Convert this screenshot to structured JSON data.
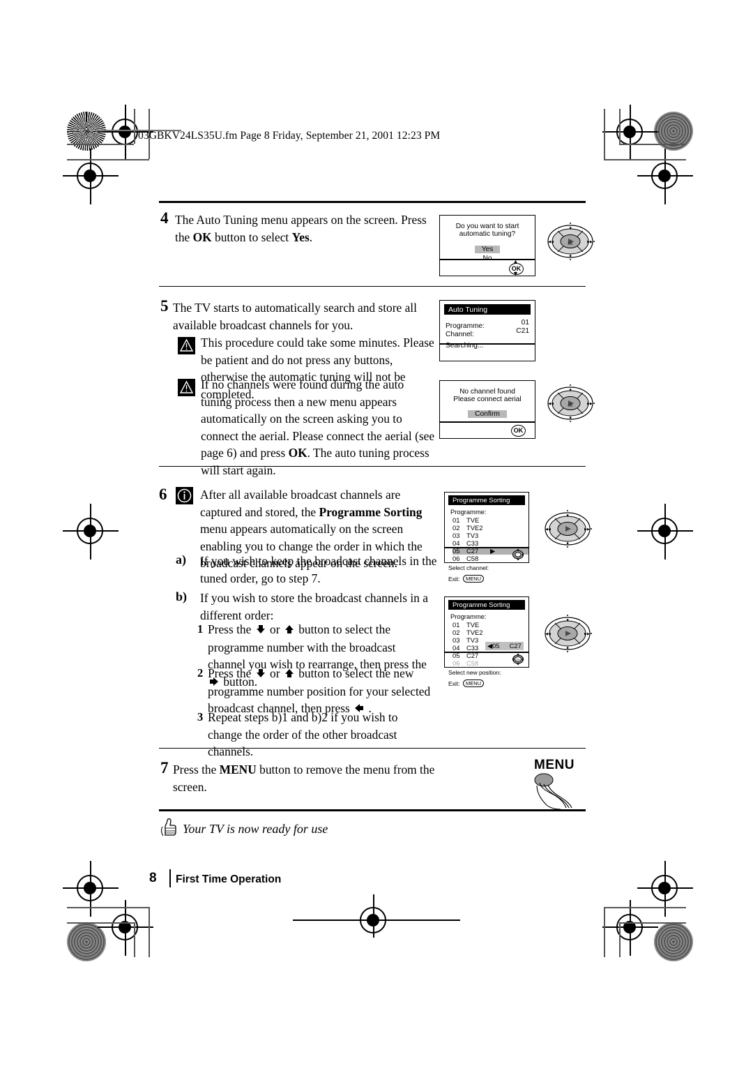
{
  "document": {
    "header": "03GBKV24LS35U.fm  Page 8  Friday, September 21, 2001  12:23 PM",
    "footer_page": "8",
    "footer_section": "First Time Operation",
    "ready_note": "Your TV is now ready for use"
  },
  "steps": {
    "step4": {
      "number": "4",
      "text_part1": "The Auto Tuning menu appears on the screen. Press the ",
      "text_bold1": "OK",
      "text_part2": " button to select ",
      "text_bold2": "Yes",
      "text_part3": "."
    },
    "step5": {
      "number": "5",
      "text": "The TV starts to automatically search and store all available broadcast channels for you.",
      "warning1": "This procedure could take some minutes. Please be patient and do not press any buttons, otherwise the automatic tuning will not be completed.",
      "warning2_part1": "If no channels were found during the auto tuning process then a new menu appears automatically on the screen asking you to connect the aerial. Please connect the aerial (see page 6) and press ",
      "warning2_bold": "OK",
      "warning2_part2": ". The auto tuning process will start again."
    },
    "step6": {
      "number": "6",
      "info_part1": "After all available broadcast channels are captured and stored, the ",
      "info_bold": "Programme Sorting",
      "info_part2": " menu appears automatically on the screen enabling you to change the order in which the broadcast channels appear on the screen.",
      "item_a_label": "a)",
      "item_a_text": "If you wish to keep the broadcast channels in the tuned order, go to step 7.",
      "item_b_label": "b)",
      "item_b_text": "If you wish to store the broadcast channels in a different order:",
      "b1_label": "1",
      "b1_text_1": "Press the ",
      "b1_text_2": " or ",
      "b1_text_3": " button to select the programme number with the broadcast channel you wish to rearrange, then press the ",
      "b1_text_4": " button.",
      "b2_label": "2",
      "b2_text_1": "Press the ",
      "b2_text_2": " or ",
      "b2_text_3": " button to select the new programme number position for your selected broadcast channel, then press ",
      "b2_text_4": " .",
      "b3_label": "3",
      "b3_text": "Repeat steps b)1 and b)2 if you wish to change the order of the other broadcast channels."
    },
    "step7": {
      "number": "7",
      "text_part1": "Press the ",
      "text_bold": "MENU",
      "text_part2": " button to remove the menu from the screen.",
      "button_label": "MENU"
    }
  },
  "screens": {
    "auto_tuning_confirm": {
      "prompt_line1": "Do you want to start",
      "prompt_line2": "automatic tuning?",
      "option_yes": "Yes",
      "option_no": "No",
      "ok_label": "OK"
    },
    "auto_tuning_progress": {
      "title": "Auto Tuning",
      "label_programme": "Programme:",
      "value_programme": "01",
      "label_channel": "Channel:",
      "value_channel": "C21",
      "status": "Searching..."
    },
    "no_channel": {
      "line1": "No channel found",
      "line2": "Please connect aerial",
      "button": "Confirm",
      "ok_label": "OK"
    },
    "programme_sorting_1": {
      "title": "Programme Sorting",
      "list_label": "Programme:",
      "rows": [
        {
          "num": "01",
          "name": "TVE"
        },
        {
          "num": "02",
          "name": "TVE2"
        },
        {
          "num": "03",
          "name": "TV3"
        },
        {
          "num": "04",
          "name": "C33"
        },
        {
          "num": "05",
          "name": "C27"
        },
        {
          "num": "06",
          "name": "C58"
        }
      ],
      "selected_index": 4,
      "footer_line1": "Select channel:",
      "footer_line2_label": "Exit:",
      "footer_menu": "MENU"
    },
    "programme_sorting_2": {
      "title": "Programme Sorting",
      "list_label": "Programme:",
      "rows": [
        {
          "num": "01",
          "name": "TVE"
        },
        {
          "num": "02",
          "name": "TVE2"
        },
        {
          "num": "03",
          "name": "TV3"
        },
        {
          "num": "04",
          "name": "C33"
        },
        {
          "num": "05",
          "name": "C27"
        },
        {
          "num": "06",
          "name": "C58"
        }
      ],
      "ghost_index": 5,
      "floating_num": "05",
      "floating_name": "C27",
      "footer_line1": "Select new position:",
      "footer_line2_label": "Exit:",
      "footer_menu": "MENU",
      "ok_label": "OK"
    }
  },
  "glyphs": {
    "arrow_down": "⬇",
    "arrow_up": "⬆",
    "arrow_right": "⮕",
    "arrow_left": "⬅",
    "triangle_right": "▶",
    "triangle_left": "◀"
  }
}
